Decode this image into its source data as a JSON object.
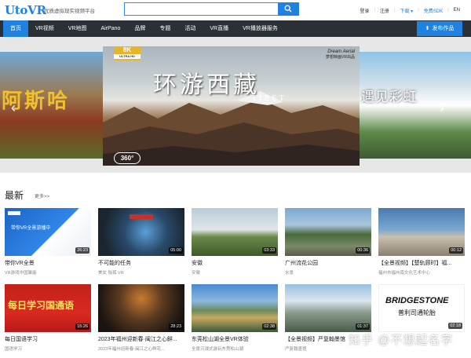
{
  "header": {
    "logo": "UtoVR",
    "slogan": "优质虚拟现实视频平台",
    "search_placeholder": "",
    "links": [
      "登录",
      "注册",
      "下载 ▾",
      "免费SDK",
      "EN"
    ]
  },
  "nav": {
    "items": [
      "首页",
      "VR视频",
      "VR地图",
      "AirPano",
      "品牌",
      "专题",
      "活动",
      "VR直播",
      "VR播放器服务"
    ],
    "active_index": 0,
    "publish_label": "发布作品"
  },
  "banner": {
    "left_text": "阿斯哈",
    "right_text": "遇见彩虹",
    "main": {
      "badge_res": "8K",
      "badge_sub": "ULTRA HD",
      "title": "环游西藏",
      "subtitle": "TIBET",
      "brand": "Dream Aerial",
      "brand_sub": "梦想映画VR出品",
      "badge_360": "360°"
    },
    "prev_arrow": "‹",
    "next_arrow": "›"
  },
  "latest": {
    "title": "最新",
    "more": "更多>>",
    "cards": [
      {
        "title": "带你VR全景",
        "sub": "VR游戏中国聚能",
        "duration": "26:23",
        "overlay": "带你VR全景游播中"
      },
      {
        "title": "不可能的任务",
        "sub": "美女  独孤  VR",
        "duration": "05:00",
        "overlay": ""
      },
      {
        "title": "安徽",
        "sub": "安徽",
        "duration": "03:33",
        "overlay": ""
      },
      {
        "title": "广州流花公园",
        "sub": "水景",
        "duration": "00:36",
        "overlay": ""
      },
      {
        "title": "【全景视频】【楚轨顾时】福...",
        "sub": "福州市福州南文化艺术中心",
        "duration": "00:12",
        "overlay": ""
      },
      {
        "title": "每日国语学习",
        "sub": "国语学习",
        "duration": "15:26",
        "overlay": "每日学习国通语"
      },
      {
        "title": "2023年福州迎新春·闽江之心鲜...",
        "sub": "2023年福州迎新春·闽江之心鲜花...",
        "duration": "28:23",
        "overlay": ""
      },
      {
        "title": "东莞松山湖全景VR体验",
        "sub": "全景沉浸式游玩东莞松山湖",
        "duration": "02:38",
        "overlay": ""
      },
      {
        "title": "【全景视频】严复翰墨馆",
        "sub": "严复翰墨馆",
        "duration": "01:37",
        "overlay": ""
      },
      {
        "title": "",
        "sub": "",
        "duration": "02:18",
        "overlay": "BRIDGESTONE",
        "overlay2": "普利司通轮胎"
      }
    ]
  },
  "watermark": "知乎 @不想起名字",
  "colors": {
    "accent": "#1f82e0",
    "nav_bg": "#2b2f36"
  }
}
